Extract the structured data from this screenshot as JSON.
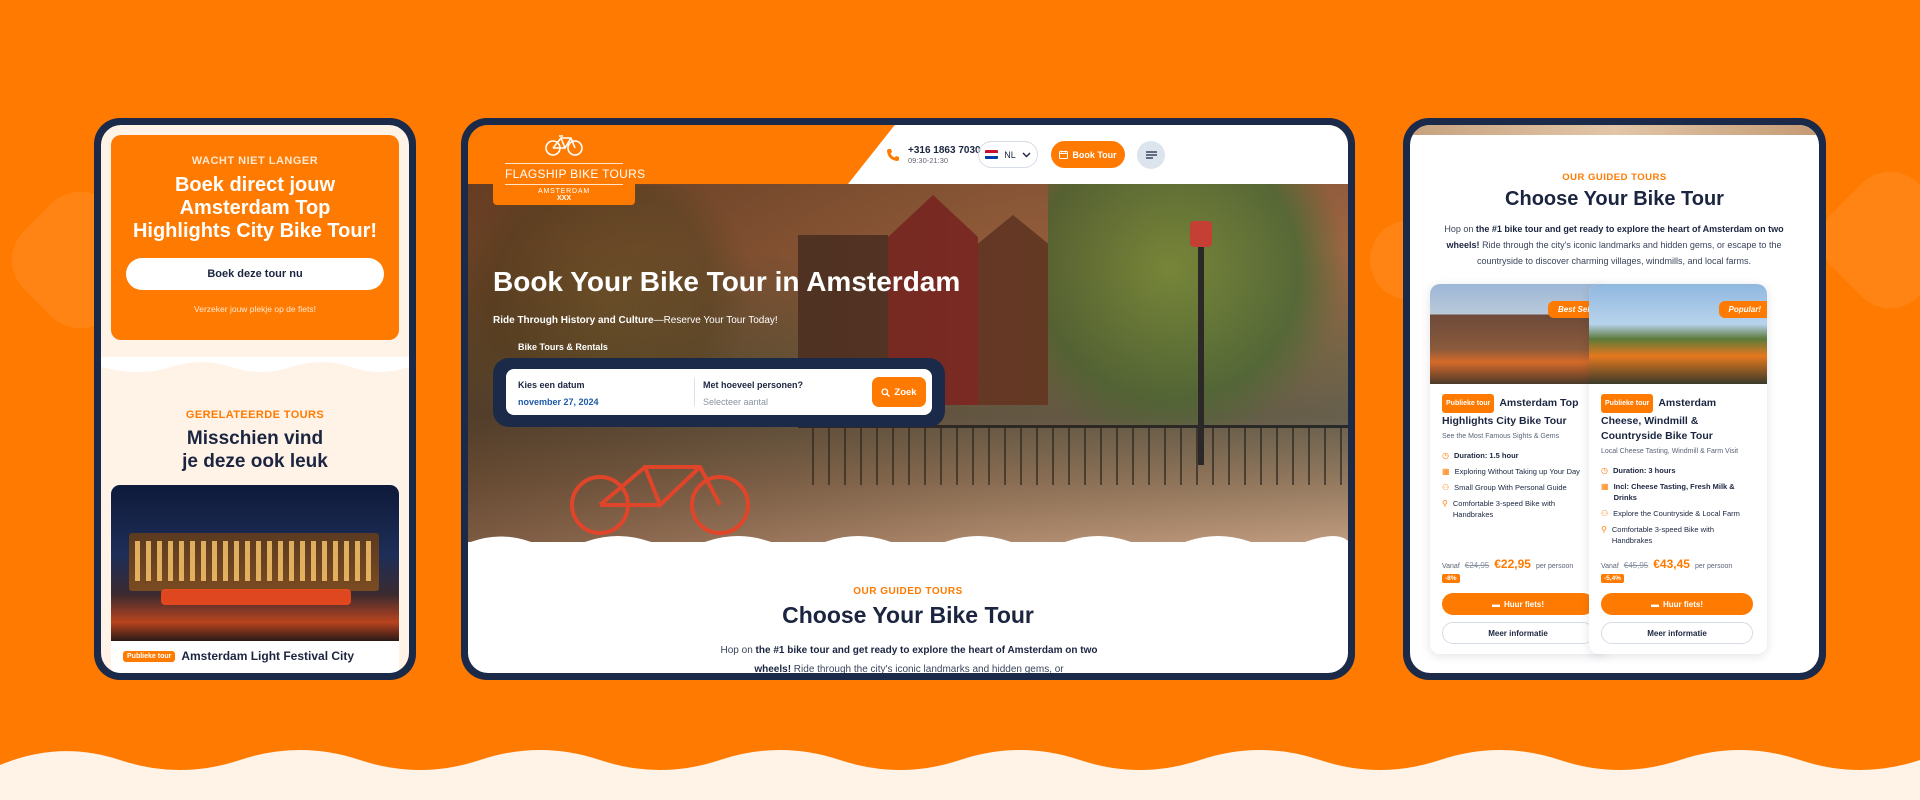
{
  "colors": {
    "background": "#FF7A00",
    "accent": "#FF7A00",
    "navy": "#1C2A4A",
    "text": "#1B2540"
  },
  "left_mobile": {
    "cta": {
      "eyebrow": "WACHT NIET LANGER",
      "title": "Boek direct jouw Amsterdam Top Highlights City Bike Tour!",
      "button": "Boek deze tour nu",
      "note": "Verzeker jouw plekje op de fiets!"
    },
    "related": {
      "eyebrow": "GERELATEERDE TOURS",
      "title_line1": "Misschien vind",
      "title_line2": "je deze ook leuk",
      "card": {
        "badge": "Publieke tour",
        "title": "Amsterdam Light Festival City"
      }
    }
  },
  "desktop": {
    "logo": {
      "name": "FLAGSHIP BIKE TOURS",
      "city": "AMSTERDAM",
      "mark": "XXX"
    },
    "phone": {
      "number": "+316 1863 7030",
      "hours": "09:30-21:30",
      "icon": "phone-icon"
    },
    "language": {
      "code": "NL",
      "icon": "chevron-down-icon"
    },
    "book_button": "Book Tour",
    "menu_icon": "hamburger-icon",
    "hero": {
      "title": "Book Your Bike Tour in Amsterdam",
      "subtitle_bold": "Ride Through History and Culture",
      "subtitle_rest": "—Reserve Your Tour Today!",
      "tab": "Bike Tours & Rentals"
    },
    "search": {
      "date_label": "Kies een datum",
      "date_value": "november 27, 2024",
      "persons_label": "Met hoeveel personen?",
      "persons_placeholder": "Selecteer aantal",
      "button": "Zoek"
    },
    "section": {
      "eyebrow": "OUR GUIDED TOURS",
      "title": "Choose Your Bike Tour",
      "body_pre": "Hop on ",
      "body_bold": "the #1 bike tour and get ready to explore the heart of Amsterdam on two wheels!",
      "body_post": " Ride through the city's iconic landmarks and hidden gems, or"
    }
  },
  "right_tablet": {
    "section": {
      "eyebrow": "OUR GUIDED TOURS",
      "title": "Choose Your Bike Tour",
      "body_pre": "Hop on ",
      "body_bold": "the #1 bike tour and get ready to explore the heart of Amsterdam on two wheels!",
      "body_post": " Ride through the city's iconic landmarks and hidden gems, or escape to the countryside to discover charming villages, windmills, and local farms."
    },
    "cards": [
      {
        "ribbon": "Best Seller!",
        "badge": "Publieke tour",
        "title": "Amsterdam Top Highlights City Bike Tour",
        "subtitle": "See the Most Famous Sights & Gems",
        "features": [
          {
            "text": "Duration: 1.5 hour",
            "strong": true,
            "icon": "clock-icon"
          },
          {
            "text": "Exploring Without Taking up Your Day",
            "strong": false,
            "icon": "calendar-icon"
          },
          {
            "text": "Small Group With Personal Guide",
            "strong": false,
            "icon": "group-icon"
          },
          {
            "text": "Comfortable 3-speed Bike with Handbrakes",
            "strong": false,
            "icon": "bike-icon"
          }
        ],
        "price_from": "Vanaf",
        "price_old": "€24,95",
        "price_new": "€22,95",
        "price_per": "per persoon",
        "discount": "-8%",
        "rent_button": "Huur fiets!",
        "info_button": "Meer informatie"
      },
      {
        "ribbon": "Popular!",
        "badge": "Publieke tour",
        "title": "Amsterdam Cheese, Windmill & Countryside Bike Tour",
        "subtitle": "Local Cheese Tasting, Windmill & Farm Visit",
        "features": [
          {
            "text": "Duration: 3 hours",
            "strong": true,
            "icon": "clock-icon"
          },
          {
            "text": "Incl: Cheese Tasting, Fresh Milk & Drinks",
            "strong": true,
            "icon": "ticket-icon"
          },
          {
            "text": "Explore the Countryside & Local Farm",
            "strong": false,
            "icon": "group-icon"
          },
          {
            "text": "Comfortable 3-speed Bike with Handbrakes",
            "strong": false,
            "icon": "bike-icon"
          }
        ],
        "price_from": "Vanaf",
        "price_old": "€45,95",
        "price_new": "€43,45",
        "price_per": "per persoon",
        "discount": "-5,4%",
        "rent_button": "Huur fiets!",
        "info_button": "Meer informatie"
      }
    ]
  }
}
